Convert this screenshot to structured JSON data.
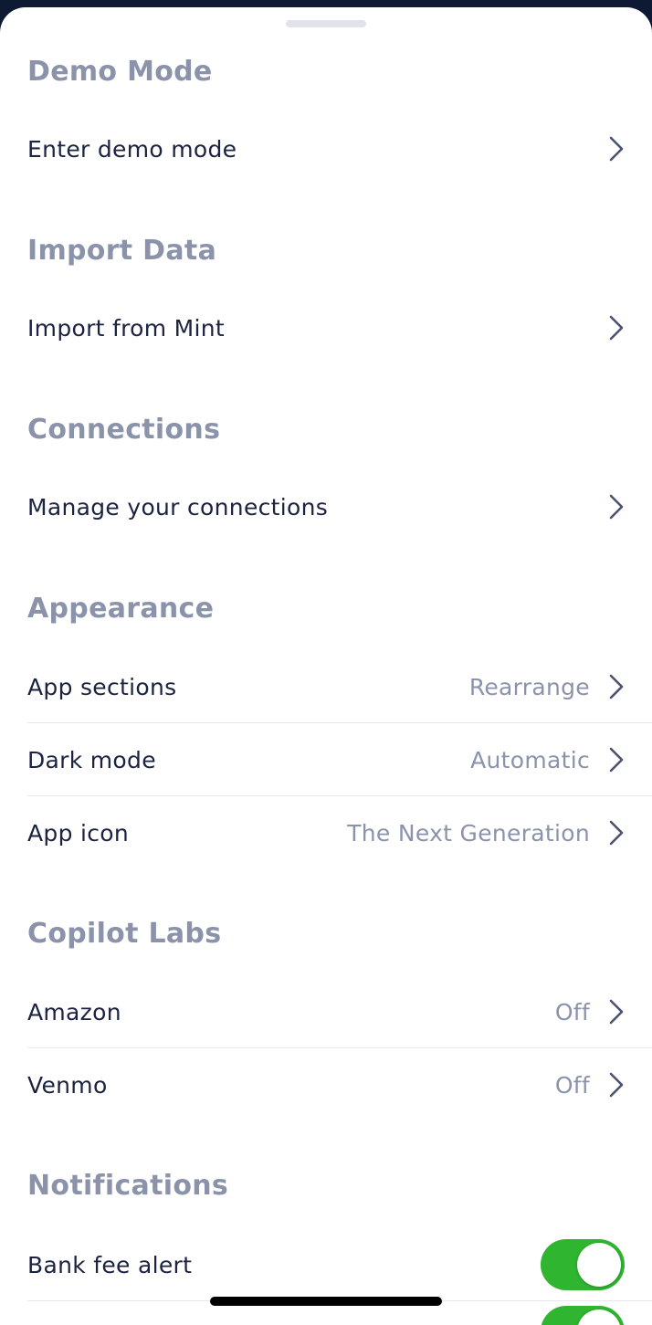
{
  "sections": {
    "demo": {
      "title": "Demo Mode",
      "rows": [
        {
          "label": "Enter demo mode"
        }
      ]
    },
    "import": {
      "title": "Import Data",
      "rows": [
        {
          "label": "Import from Mint"
        }
      ]
    },
    "connections": {
      "title": "Connections",
      "rows": [
        {
          "label": "Manage your connections"
        }
      ]
    },
    "appearance": {
      "title": "Appearance",
      "rows": [
        {
          "label": "App sections",
          "value": "Rearrange"
        },
        {
          "label": "Dark mode",
          "value": "Automatic"
        },
        {
          "label": "App icon",
          "value": "The Next Generation"
        }
      ]
    },
    "labs": {
      "title": "Copilot Labs",
      "rows": [
        {
          "label": "Amazon",
          "value": "Off"
        },
        {
          "label": "Venmo",
          "value": "Off"
        }
      ]
    },
    "notifications": {
      "title": "Notifications",
      "rows": [
        {
          "label": "Bank fee alert",
          "enabled": true
        }
      ]
    }
  },
  "icons": {
    "chevron": "chevron-right-icon",
    "grabber": "sheet-grabber"
  },
  "colors": {
    "section_title": "#8b93ab",
    "row_label": "#1c2340",
    "row_value": "#8b93ab",
    "toggle_on": "#2fb52f",
    "divider": "#e6e8ee"
  }
}
